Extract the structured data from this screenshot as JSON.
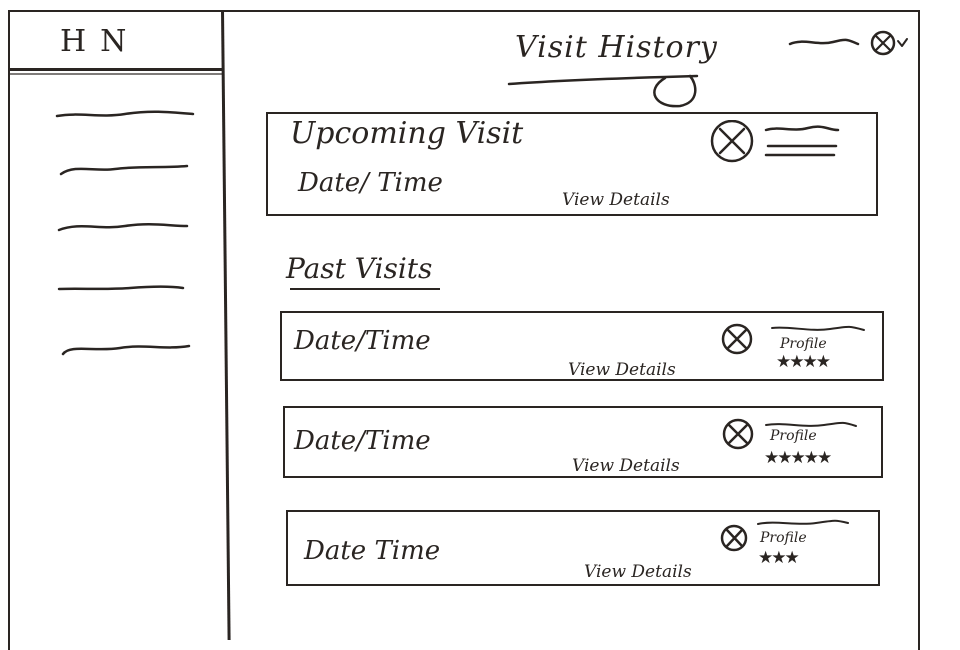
{
  "app": {
    "logo": "HN"
  },
  "header": {
    "title": "Visit History"
  },
  "upcoming": {
    "heading": "Upcoming Visit",
    "datetime": "Date/ Time",
    "details_label": "View Details"
  },
  "past": {
    "heading": "Past Visits",
    "visits": [
      {
        "datetime": "Date/Time",
        "details_label": "View Details",
        "profile_label": "Profile",
        "stars": "★★★★"
      },
      {
        "datetime": "Date/Time",
        "details_label": "View Details",
        "profile_label": "Profile",
        "stars": "★★★★★"
      },
      {
        "datetime": "Date Time",
        "details_label": "View Details",
        "profile_label": "Profile",
        "stars": "★★★"
      }
    ]
  }
}
